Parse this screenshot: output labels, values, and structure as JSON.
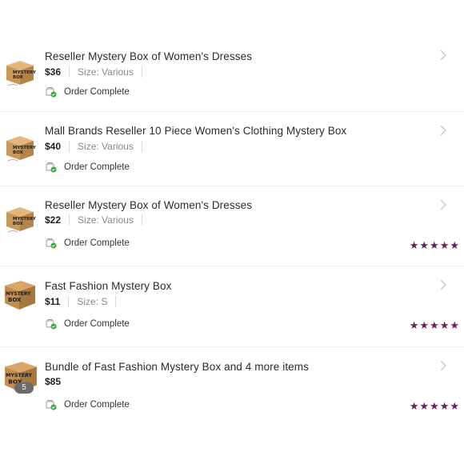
{
  "orders": [
    {
      "title": "Reseller Mystery Box of Women's Dresses",
      "price": "$36",
      "size": "Size: Various",
      "status": "Order Complete",
      "thumb_style": "branded",
      "thumb_text": [
        "MYSTERY",
        "BOX"
      ],
      "has_rating": false
    },
    {
      "title": "Mall Brands Reseller 10 Piece Women's Clothing Mystery Box",
      "price": "$40",
      "size": "Size: Various",
      "status": "Order Complete",
      "thumb_style": "branded",
      "thumb_text": [
        "MYSTERY",
        "BOX"
      ],
      "has_rating": false
    },
    {
      "title": "Reseller Mystery Box of Women's Dresses",
      "price": "$22",
      "size": "Size: Various",
      "status": "Order Complete",
      "thumb_style": "branded",
      "thumb_text": [
        "MYSTERY",
        "BOX"
      ],
      "has_rating": true,
      "rating": 5
    },
    {
      "title": "Fast Fashion Mystery Box",
      "price": "$11",
      "size": "Size: S",
      "status": "Order Complete",
      "thumb_style": "plain",
      "thumb_text": [
        "MYSTERY",
        "BOX"
      ],
      "has_rating": true,
      "rating": 5
    },
    {
      "title": "Bundle of Fast Fashion Mystery Box and 4 more items",
      "price": "$85",
      "size": "",
      "status": "Order Complete",
      "thumb_style": "plain",
      "thumb_text": [
        "MYSTERY",
        "BOX"
      ],
      "bundle_count": "5",
      "has_rating": true,
      "rating": 5
    }
  ],
  "colors": {
    "star": "#6b1d5c",
    "status_check": "#3aa845",
    "box": "#c9995b"
  }
}
